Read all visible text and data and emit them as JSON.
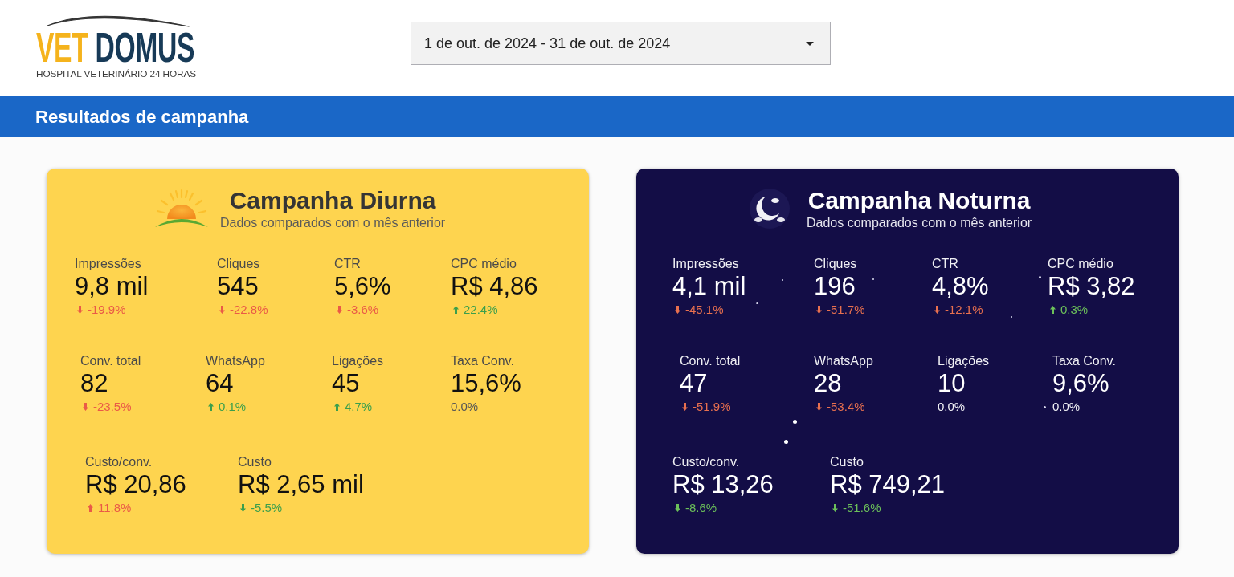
{
  "logo": {
    "wordmark_part_1": "VET",
    "wordmark_part_2": "DOMUS",
    "tagline": "HOSPITAL VETERINÁRIO 24 HORAS"
  },
  "date_range": {
    "value": "1 de out. de 2024 - 31 de out. de 2024"
  },
  "section_bar": {
    "title": "Resultados de campanha"
  },
  "cards": [
    {
      "kind": "day",
      "title": "Campanha Diurna",
      "subtitle": "Dados comparados com o mês anterior",
      "metric_rows": [
        [
          {
            "label": "Impressões",
            "value": "9,8 mil",
            "change": "-19.9%",
            "kind": "down",
            "color": "#ea5a47"
          },
          {
            "label": "Cliques",
            "value": "545",
            "change": "-22.8%",
            "kind": "down",
            "color": "#ea5a47"
          },
          {
            "label": "CTR",
            "value": "5,6%",
            "change": "-3.6%",
            "kind": "down",
            "color": "#ea5a47"
          },
          {
            "label": "CPC médio",
            "value": "R$ 4,86",
            "change": "22.4%",
            "kind": "up",
            "color": "#3b9f4c"
          }
        ],
        [
          {
            "label": "Conv. total",
            "value": "82",
            "change": "-23.5%",
            "kind": "down",
            "color": "#ea5a47"
          },
          {
            "label": "WhatsApp",
            "value": "64",
            "change": "0.1%",
            "kind": "up",
            "color": "#3b9f4c"
          },
          {
            "label": "Ligações",
            "value": "45",
            "change": "4.7%",
            "kind": "up",
            "color": "#3b9f4c"
          },
          {
            "label": "Taxa Conv.",
            "value": "15,6%",
            "change": "0.0%",
            "kind": "flat",
            "color": "#555555"
          }
        ],
        [
          {
            "label": "Custo/conv.",
            "value": "R$ 20,86",
            "change": "11.8%",
            "kind": "up",
            "color": "#ea5a47"
          },
          {
            "label": "Custo",
            "value": "R$ 2,65 mil",
            "change": "-5.5%",
            "kind": "down",
            "color": "#3b9f4c"
          }
        ]
      ]
    },
    {
      "kind": "night",
      "title": "Campanha Noturna",
      "subtitle": "Dados comparados com o mês anterior",
      "metric_rows": [
        [
          {
            "label": "Impressões",
            "value": "4,1 mil",
            "change": "-45.1%",
            "kind": "down",
            "color": "#e8704f"
          },
          {
            "label": "Cliques",
            "value": "196",
            "change": "-51.7%",
            "kind": "down",
            "color": "#e8704f"
          },
          {
            "label": "CTR",
            "value": "4,8%",
            "change": "-12.1%",
            "kind": "down",
            "color": "#e8704f"
          },
          {
            "label": "CPC médio",
            "value": "R$ 3,82",
            "change": "0.3%",
            "kind": "up",
            "color": "#6cc05a"
          }
        ],
        [
          {
            "label": "Conv. total",
            "value": "47",
            "change": "-51.9%",
            "kind": "down",
            "color": "#e8704f"
          },
          {
            "label": "WhatsApp",
            "value": "28",
            "change": "-53.4%",
            "kind": "down",
            "color": "#e8704f"
          },
          {
            "label": "Ligações",
            "value": "10",
            "change": "0.0%",
            "kind": "flat",
            "color": "#f0f0f4"
          },
          {
            "label": "Taxa Conv.",
            "value": "9,6%",
            "change": "0.0%",
            "kind": "flat",
            "color": "#f0f0f4"
          }
        ],
        [
          {
            "label": "Custo/conv.",
            "value": "R$ 13,26",
            "change": "-8.6%",
            "kind": "down",
            "color": "#6cc05a"
          },
          {
            "label": "Custo",
            "value": "R$ 749,21",
            "change": "-51.6%",
            "kind": "down",
            "color": "#6cc05a"
          }
        ]
      ]
    }
  ]
}
